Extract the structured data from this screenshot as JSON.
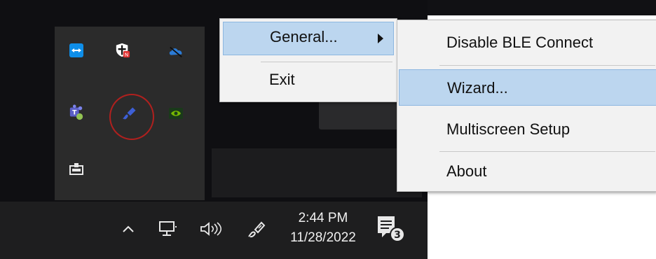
{
  "context_menu": {
    "items": [
      {
        "label": "General...",
        "has_submenu": true,
        "highlighted": true
      },
      {
        "label": "Exit"
      }
    ]
  },
  "submenu": {
    "items": [
      {
        "label": "Disable BLE Connect"
      },
      {
        "label": "Wizard...",
        "highlighted": true
      },
      {
        "label": "Multiscreen Setup"
      },
      {
        "label": "About"
      }
    ]
  },
  "tray_overflow": {
    "icons": [
      "teamviewer-icon",
      "security-shield-icon",
      "onedrive-icon",
      "teams-icon",
      "stylus-app-icon",
      "nvidia-icon",
      "safely-remove-hardware-icon"
    ],
    "highlighted_icon": "stylus-app-icon"
  },
  "taskbar": {
    "chevron": "chevron-up-icon",
    "network": "network-icon",
    "volume": "volume-icon",
    "stylus": "stylus-tray-icon",
    "time": "2:44 PM",
    "date": "11/28/2022",
    "notifications_count": "3"
  },
  "colors": {
    "menu_highlight": "#bcd6ef",
    "taskbar": "#1e1e1f",
    "circle": "#b0201e"
  }
}
